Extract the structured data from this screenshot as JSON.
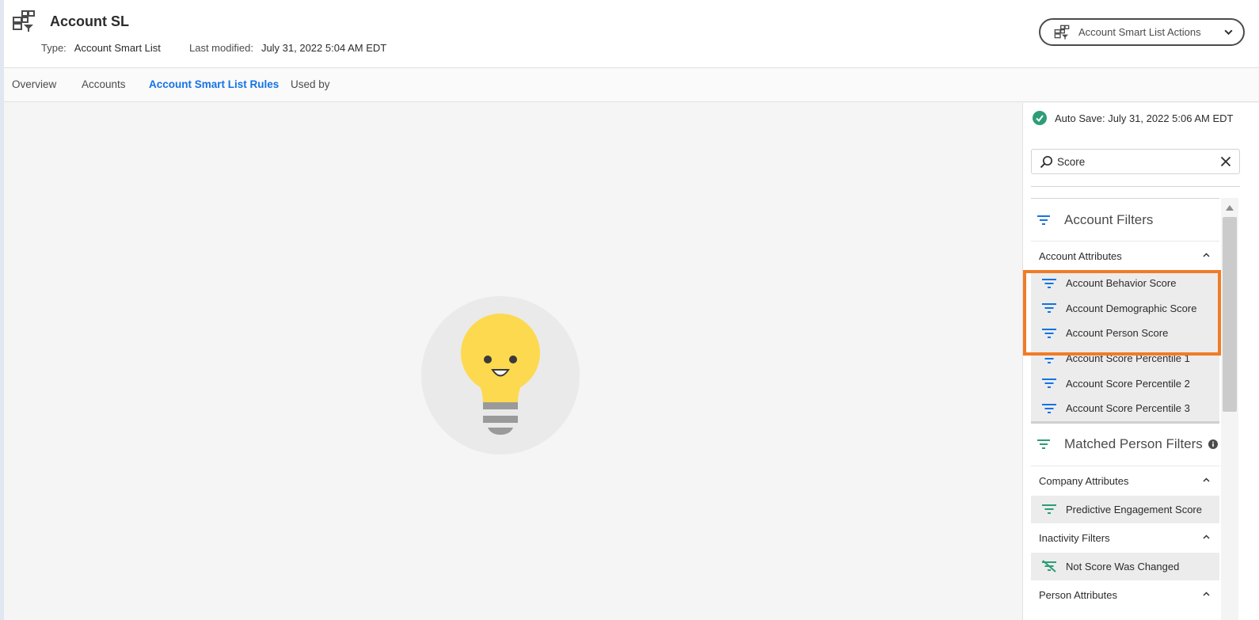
{
  "header": {
    "title": "Account SL",
    "type_label": "Type:",
    "type_value": "Account Smart List",
    "modified_label": "Last modified:",
    "modified_value": "July 31, 2022 5:04 AM EDT",
    "actions_label": "Account Smart List Actions"
  },
  "tabs": [
    {
      "label": "Overview"
    },
    {
      "label": "Accounts"
    },
    {
      "label": "Account Smart List Rules"
    },
    {
      "label": "Used by"
    }
  ],
  "sidebar": {
    "autosave": "Auto Save: July 31, 2022 5:06 AM EDT",
    "search": {
      "value": "Score"
    },
    "groups": [
      {
        "title": "Account Filters",
        "sections": [
          {
            "label": "Account Attributes",
            "items": [
              "Account Behavior Score",
              "Account Demographic Score",
              "Account Person Score",
              "Account Score Percentile 1",
              "Account Score Percentile 2",
              "Account Score Percentile 3"
            ]
          }
        ]
      },
      {
        "title": "Matched Person Filters",
        "sections": [
          {
            "label": "Company Attributes",
            "items": [
              "Predictive Engagement Score"
            ]
          },
          {
            "label": "Inactivity Filters",
            "items": [
              "Not Score Was Changed"
            ]
          },
          {
            "label": "Person Attributes",
            "items": []
          }
        ]
      }
    ]
  },
  "colors": {
    "accent": "#1473e6",
    "highlight": "#f07c27",
    "success": "#2d9d78",
    "person_filter": "#2d9d78"
  },
  "icons": {
    "app": "smart-list-icon",
    "actions": "smart-list-icon",
    "autosave": "check-circle-icon",
    "search": "search-icon",
    "clear": "close-icon",
    "filter": "filter-icon",
    "inactivity": "filter-off-icon",
    "info": "info-icon"
  }
}
